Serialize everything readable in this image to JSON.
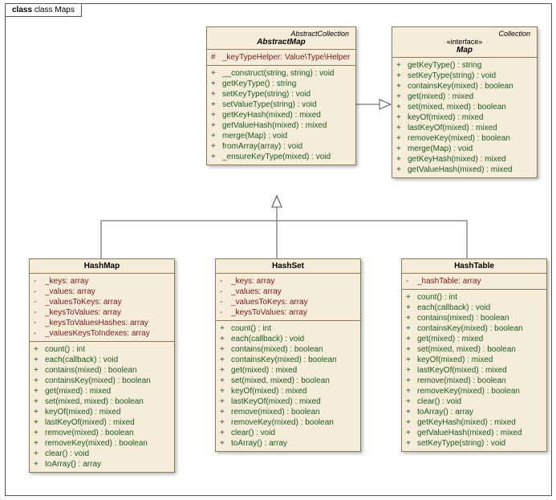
{
  "title": "class Maps",
  "abstractMap": {
    "stereo": "AbstractCollection",
    "name": "AbstractMap",
    "attrs": [
      {
        "v": "#",
        "t": "_keyTypeHelper: Value\\Type\\Helper"
      }
    ],
    "ops": [
      {
        "v": "+",
        "t": "__construct(string, string) : void"
      },
      {
        "v": "+",
        "t": "getKeyType() : string"
      },
      {
        "v": "+",
        "t": "setKeyType(string) : void"
      },
      {
        "v": "+",
        "t": "setValueType(string) : void"
      },
      {
        "v": "+",
        "t": "getKeyHash(mixed) : mixed"
      },
      {
        "v": "+",
        "t": "getValueHash(mixed) : mixed"
      },
      {
        "v": "+",
        "t": "merge(Map) : void"
      },
      {
        "v": "+",
        "t": "fromArray(array) : void"
      },
      {
        "v": "+",
        "t": "_ensureKeyType(mixed) : void"
      }
    ]
  },
  "map": {
    "stereo": "Collection",
    "iface": "«interface»",
    "name": "Map",
    "ops": [
      {
        "v": "+",
        "t": "getKeyType() : string"
      },
      {
        "v": "+",
        "t": "setKeyType(string) : void"
      },
      {
        "v": "+",
        "t": "containsKey(mixed) : boolean"
      },
      {
        "v": "+",
        "t": "get(mixed) : mixed"
      },
      {
        "v": "+",
        "t": "set(mixed, mixed) : boolean"
      },
      {
        "v": "+",
        "t": "keyOf(mixed) : mixed"
      },
      {
        "v": "+",
        "t": "lastKeyOf(mixed) : mixed"
      },
      {
        "v": "+",
        "t": "removeKey(mixed) : boolean"
      },
      {
        "v": "+",
        "t": "merge(Map) : void"
      },
      {
        "v": "+",
        "t": "getKeyHash(mixed) : mixed"
      },
      {
        "v": "+",
        "t": "getValueHash(mixed) : mixed"
      }
    ]
  },
  "hashMap": {
    "name": "HashMap",
    "attrs": [
      {
        "v": "-",
        "t": "_keys: array"
      },
      {
        "v": "-",
        "t": "_values: array"
      },
      {
        "v": "-",
        "t": "_valuesToKeys: array"
      },
      {
        "v": "-",
        "t": "_keysToValues: array"
      },
      {
        "v": "-",
        "t": "_keysToValuesHashes: array"
      },
      {
        "v": "-",
        "t": "_valuesKeysToIndexes: array"
      }
    ],
    "ops": [
      {
        "v": "+",
        "t": "count() : int"
      },
      {
        "v": "+",
        "t": "each(callback) : void"
      },
      {
        "v": "+",
        "t": "contains(mixed) : boolean"
      },
      {
        "v": "+",
        "t": "containsKey(mixed) : boolean"
      },
      {
        "v": "+",
        "t": "get(mixed) : mixed"
      },
      {
        "v": "+",
        "t": "set(mixed, mixed) : boolean"
      },
      {
        "v": "+",
        "t": "keyOf(mixed) : mixed"
      },
      {
        "v": "+",
        "t": "lastKeyOf(mixed) : mixed"
      },
      {
        "v": "+",
        "t": "remove(mixed) : boolean"
      },
      {
        "v": "+",
        "t": "removeKey(mixed) : boolean"
      },
      {
        "v": "+",
        "t": "clear() : void"
      },
      {
        "v": "+",
        "t": "toArray() : array"
      }
    ]
  },
  "hashSet": {
    "name": "HashSet",
    "attrs": [
      {
        "v": "-",
        "t": "_keys: array"
      },
      {
        "v": "-",
        "t": "_values: array"
      },
      {
        "v": "-",
        "t": "_valuesToKeys: array"
      },
      {
        "v": "-",
        "t": "_keysToValues: array"
      }
    ],
    "ops": [
      {
        "v": "+",
        "t": "count() : int"
      },
      {
        "v": "+",
        "t": "each(callback) : void"
      },
      {
        "v": "+",
        "t": "contains(mixed) : boolean"
      },
      {
        "v": "+",
        "t": "containsKey(mixed) : boolean"
      },
      {
        "v": "+",
        "t": "get(mixed) : mixed"
      },
      {
        "v": "+",
        "t": "set(mixed, mixed) : boolean"
      },
      {
        "v": "+",
        "t": "keyOf(mixed) : mixed"
      },
      {
        "v": "+",
        "t": "lastKeyOf(mixed) : mixed"
      },
      {
        "v": "+",
        "t": "remove(mixed) : boolean"
      },
      {
        "v": "+",
        "t": "removeKey(mixed) : boolean"
      },
      {
        "v": "+",
        "t": "clear() : void"
      },
      {
        "v": "+",
        "t": "toArray() : array"
      }
    ]
  },
  "hashTable": {
    "name": "HashTable",
    "attrs": [
      {
        "v": "-",
        "t": "_hashTable: array"
      }
    ],
    "ops": [
      {
        "v": "+",
        "t": "count() : int"
      },
      {
        "v": "+",
        "t": "each(callback) : void"
      },
      {
        "v": "+",
        "t": "contains(mixed) : boolean"
      },
      {
        "v": "+",
        "t": "containsKey(mixed) : boolean"
      },
      {
        "v": "+",
        "t": "get(mixed) : mixed"
      },
      {
        "v": "+",
        "t": "set(mixed, mixed) : boolean"
      },
      {
        "v": "+",
        "t": "keyOf(mixed) : mixed"
      },
      {
        "v": "+",
        "t": "lastKeyOf(mixed) : mixed"
      },
      {
        "v": "+",
        "t": "remove(mixed) : boolean"
      },
      {
        "v": "+",
        "t": "removeKey(mixed) : boolean"
      },
      {
        "v": "+",
        "t": "clear() : void"
      },
      {
        "v": "+",
        "t": "toArray() : array"
      },
      {
        "v": "+",
        "t": "getKeyHash(mixed) : mixed"
      },
      {
        "v": "+",
        "t": "getValueHash(mixed) : mixed"
      },
      {
        "v": "+",
        "t": "setKeyType(string) : void"
      }
    ]
  }
}
